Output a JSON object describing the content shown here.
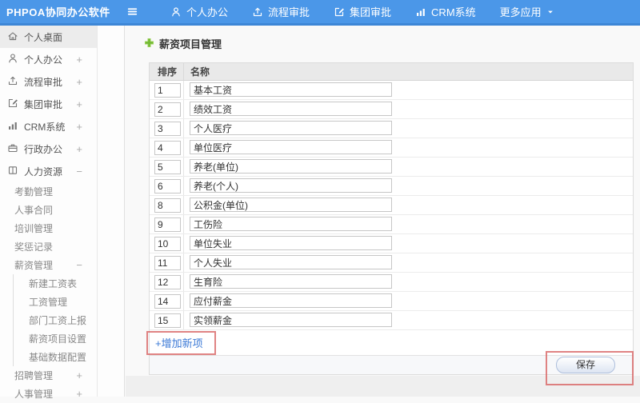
{
  "topbar": {
    "logo": "PHPOA协同办公软件",
    "nav": [
      {
        "label": "个人办公",
        "icon": "person-icon"
      },
      {
        "label": "流程审批",
        "icon": "process-icon"
      },
      {
        "label": "集团审批",
        "icon": "edit-icon"
      },
      {
        "label": "CRM系统",
        "icon": "chart-icon"
      },
      {
        "label": "更多应用",
        "icon": "caret-down-icon"
      }
    ]
  },
  "sidebar": {
    "items": [
      {
        "label": "个人桌面",
        "expand": ""
      },
      {
        "label": "个人办公",
        "expand": "+"
      },
      {
        "label": "流程审批",
        "expand": "+"
      },
      {
        "label": "集团审批",
        "expand": "+"
      },
      {
        "label": "CRM系统",
        "expand": "+"
      },
      {
        "label": "行政办公",
        "expand": "+"
      },
      {
        "label": "人力资源",
        "expand": "−"
      }
    ],
    "sub_items": [
      {
        "label": "考勤管理"
      },
      {
        "label": "人事合同"
      },
      {
        "label": "培训管理"
      },
      {
        "label": "奖惩记录"
      }
    ],
    "salary_group": {
      "label": "薪资管理",
      "expand": "−"
    },
    "salary_children": [
      "新建工资表",
      "工资管理",
      "部门工资上报",
      "薪资项目设置",
      "基础数据配置"
    ],
    "tail_items": [
      {
        "label": "招聘管理",
        "expand": "+"
      },
      {
        "label": "人事管理",
        "expand": "+"
      }
    ]
  },
  "main": {
    "title": "薪资项目管理",
    "table": {
      "headers": [
        "排序",
        "名称"
      ],
      "rows": [
        {
          "order": "1",
          "name": "基本工资"
        },
        {
          "order": "2",
          "name": "绩效工资"
        },
        {
          "order": "3",
          "name": "个人医疗"
        },
        {
          "order": "4",
          "name": "单位医疗"
        },
        {
          "order": "5",
          "name": "养老(单位)"
        },
        {
          "order": "6",
          "name": "养老(个人)"
        },
        {
          "order": "8",
          "name": "公积金(单位)"
        },
        {
          "order": "9",
          "name": "工伤险"
        },
        {
          "order": "10",
          "name": "单位失业"
        },
        {
          "order": "11",
          "name": "个人失业"
        },
        {
          "order": "12",
          "name": "生育险"
        },
        {
          "order": "14",
          "name": "应付薪金"
        },
        {
          "order": "15",
          "name": "实领薪金"
        }
      ]
    },
    "add_link": "+增加新项",
    "save_label": "保存"
  },
  "colors": {
    "topbar_blue": "#4b97e8",
    "topbar_border": "#3d86d6",
    "accent_green": "#72b832",
    "link_blue": "#3b79d6",
    "annotation_red": "#d86464"
  }
}
